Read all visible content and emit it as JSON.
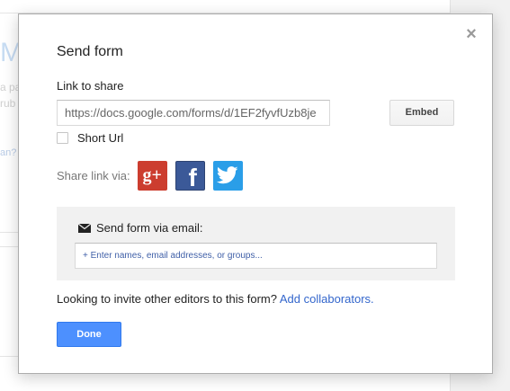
{
  "background": {
    "big_letter": "M",
    "text1": "a pa",
    "text2": "rub",
    "link": "an?"
  },
  "dialog": {
    "title": "Send form",
    "close_glyph": "×",
    "link_label": "Link to share",
    "url_value": "https://docs.google.com/forms/d/1EF2fyvfUzb8je",
    "embed_label": "Embed",
    "short_url_label": "Short Url",
    "short_url_checked": false,
    "share_label": "Share link via:",
    "social": [
      {
        "name": "google-plus",
        "glyph": "g+",
        "color": "#cc3d2f"
      },
      {
        "name": "facebook",
        "glyph": "f",
        "color": "#3b5998"
      },
      {
        "name": "twitter",
        "glyph": "bird",
        "color": "#2a9ee8"
      }
    ],
    "email": {
      "title": "Send form via email:",
      "placeholder": "+ Enter names, email addresses, or groups..."
    },
    "invite_text": "Looking to invite other editors to this form?",
    "invite_link": "Add collaborators.",
    "done_label": "Done"
  },
  "colors": {
    "primary_button": "#4d90fe",
    "link": "#3366cc",
    "panel_bg": "#f1f1f1"
  }
}
